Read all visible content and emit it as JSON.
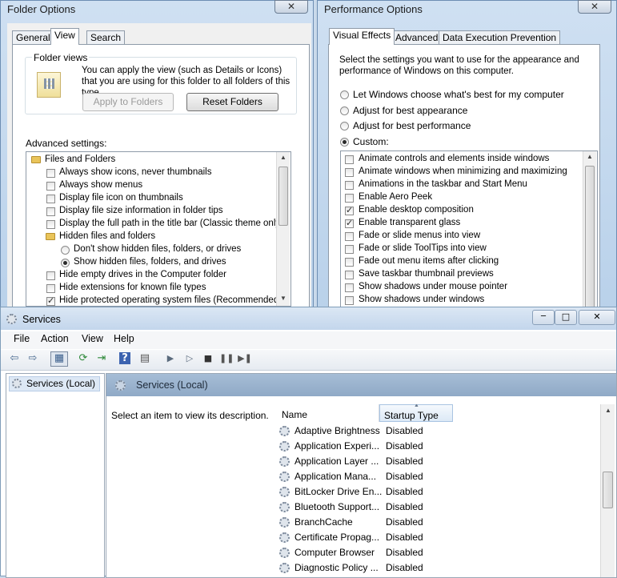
{
  "folder_options": {
    "title": "Folder Options",
    "tabs": [
      "General",
      "View",
      "Search"
    ],
    "folder_views": {
      "group_label": "Folder views",
      "description": "You can apply the view (such as Details or Icons) that you are using for this folder to all folders of this type.",
      "apply_button": "Apply to Folders",
      "reset_button": "Reset Folders"
    },
    "advanced_label": "Advanced settings:",
    "tree": [
      {
        "kind": "folder",
        "label": "Files and Folders",
        "indent": 0
      },
      {
        "kind": "checkbox",
        "label": "Always show icons, never thumbnails",
        "checked": false,
        "indent": 1
      },
      {
        "kind": "checkbox",
        "label": "Always show menus",
        "checked": false,
        "indent": 1
      },
      {
        "kind": "checkbox",
        "label": "Display file icon on thumbnails",
        "checked": false,
        "indent": 1
      },
      {
        "kind": "checkbox",
        "label": "Display file size information in folder tips",
        "checked": false,
        "indent": 1
      },
      {
        "kind": "checkbox",
        "label": "Display the full path in the title bar (Classic theme only)",
        "checked": false,
        "indent": 1
      },
      {
        "kind": "folder",
        "label": "Hidden files and folders",
        "indent": 1
      },
      {
        "kind": "radio",
        "label": "Don't show hidden files, folders, or drives",
        "checked": false,
        "indent": 2
      },
      {
        "kind": "radio",
        "label": "Show hidden files, folders, and drives",
        "checked": true,
        "indent": 2
      },
      {
        "kind": "checkbox",
        "label": "Hide empty drives in the Computer folder",
        "checked": false,
        "indent": 1
      },
      {
        "kind": "checkbox",
        "label": "Hide extensions for known file types",
        "checked": false,
        "indent": 1
      },
      {
        "kind": "checkbox",
        "label": "Hide protected operating system files (Recommended)",
        "checked": true,
        "indent": 1
      }
    ]
  },
  "performance_options": {
    "title": "Performance Options",
    "tabs": [
      "Visual Effects",
      "Advanced",
      "Data Execution Prevention"
    ],
    "intro": "Select the settings you want to use for the appearance and performance of Windows on this computer.",
    "radios": [
      {
        "label": "Let Windows choose what's best for my computer",
        "checked": false
      },
      {
        "label": "Adjust for best appearance",
        "checked": false
      },
      {
        "label": "Adjust for best performance",
        "checked": false
      },
      {
        "label": "Custom:",
        "checked": true
      }
    ],
    "effects": [
      {
        "label": "Animate controls and elements inside windows",
        "checked": false
      },
      {
        "label": "Animate windows when minimizing and maximizing",
        "checked": false
      },
      {
        "label": "Animations in the taskbar and Start Menu",
        "checked": false
      },
      {
        "label": "Enable Aero Peek",
        "checked": false
      },
      {
        "label": "Enable desktop composition",
        "checked": true
      },
      {
        "label": "Enable transparent glass",
        "checked": true
      },
      {
        "label": "Fade or slide menus into view",
        "checked": false
      },
      {
        "label": "Fade or slide ToolTips into view",
        "checked": false
      },
      {
        "label": "Fade out menu items after clicking",
        "checked": false
      },
      {
        "label": "Save taskbar thumbnail previews",
        "checked": false
      },
      {
        "label": "Show shadows under mouse pointer",
        "checked": false
      },
      {
        "label": "Show shadows under windows",
        "checked": false
      }
    ]
  },
  "services": {
    "title": "Services",
    "window_controls": {
      "minimize": "─",
      "maximize": "□",
      "close": "✕"
    },
    "menu": [
      "File",
      "Action",
      "View",
      "Help"
    ],
    "toolbar_icons": [
      "back-icon",
      "forward-icon",
      "console-tree-icon",
      "refresh-icon",
      "export-icon",
      "help-icon",
      "properties-icon",
      "play-icon",
      "play-alt-icon",
      "stop-icon",
      "pause-icon",
      "restart-icon"
    ],
    "tree_root": "Services (Local)",
    "header_title": "Services (Local)",
    "description_prompt": "Select an item to view its description.",
    "columns": [
      "Name",
      "Startup Type"
    ],
    "rows": [
      {
        "name": "Adaptive Brightness",
        "startup": "Disabled"
      },
      {
        "name": "Application Experi...",
        "startup": "Disabled"
      },
      {
        "name": "Application Layer ...",
        "startup": "Disabled"
      },
      {
        "name": "Application Mana...",
        "startup": "Disabled"
      },
      {
        "name": "BitLocker Drive En...",
        "startup": "Disabled"
      },
      {
        "name": "Bluetooth Support...",
        "startup": "Disabled"
      },
      {
        "name": "BranchCache",
        "startup": "Disabled"
      },
      {
        "name": "Certificate Propag...",
        "startup": "Disabled"
      },
      {
        "name": "Computer Browser",
        "startup": "Disabled"
      },
      {
        "name": "Diagnostic Policy ...",
        "startup": "Disabled"
      }
    ]
  }
}
